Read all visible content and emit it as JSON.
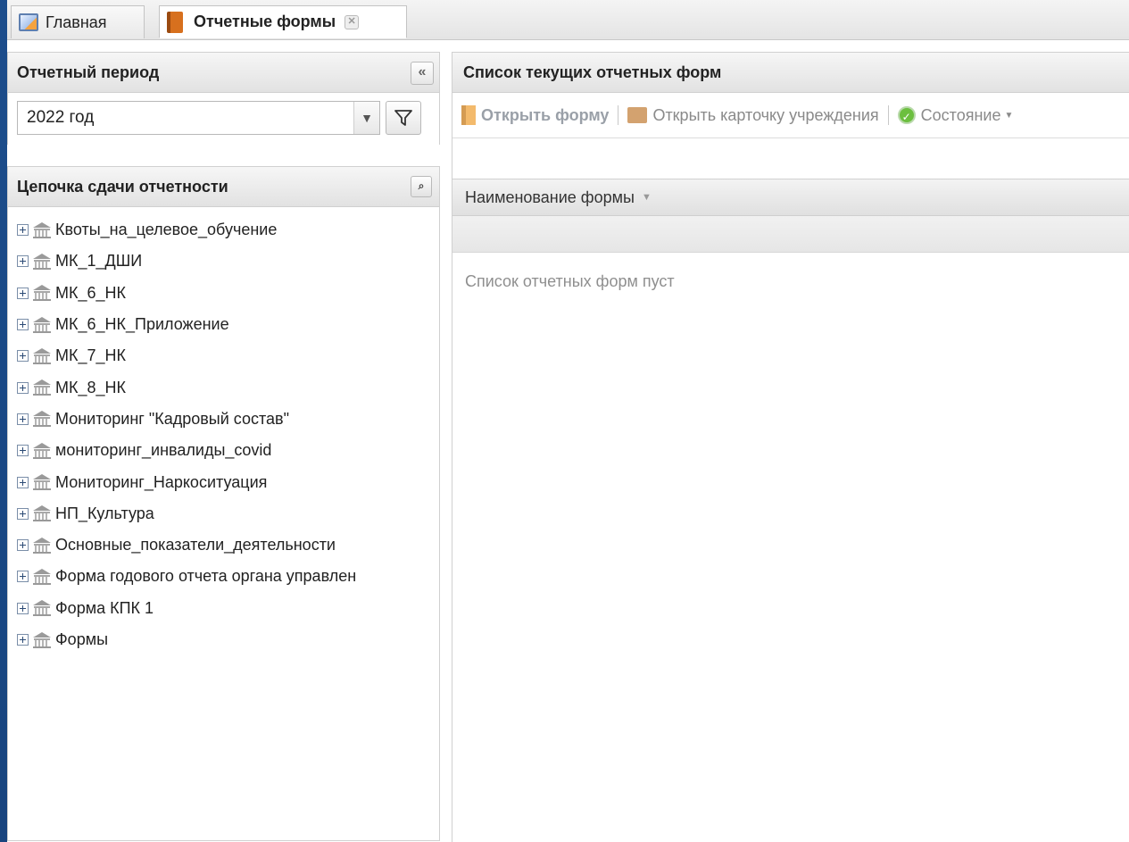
{
  "tabs": [
    {
      "label": "Главная",
      "icon": "home-icon"
    },
    {
      "label": "Отчетные формы",
      "icon": "book-icon",
      "active": true
    }
  ],
  "period_panel": {
    "title": "Отчетный период",
    "selected": "2022 год"
  },
  "chain_panel": {
    "title": "Цепочка сдачи отчетности",
    "items": [
      "Квоты_на_целевое_обучение",
      "МК_1_ДШИ",
      "МК_6_НК",
      "МК_6_НК_Приложение",
      "МК_7_НК",
      "МК_8_НК",
      "Мониторинг \"Кадровый состав\"",
      "мониторинг_инвалиды_covid",
      "Мониторинг_Наркоситуация",
      "НП_Культура",
      "Основные_показатели_деятельности",
      "Форма годового отчета органа управлен",
      "Форма КПК 1",
      "Формы"
    ]
  },
  "forms_panel": {
    "title": "Список текущих отчетных форм",
    "toolbar": {
      "open_form": "Открыть форму",
      "open_card": "Открыть карточку учреждения",
      "state": "Состояние"
    },
    "column": "Наименование формы",
    "empty_text": "Список отчетных форм пуст"
  }
}
